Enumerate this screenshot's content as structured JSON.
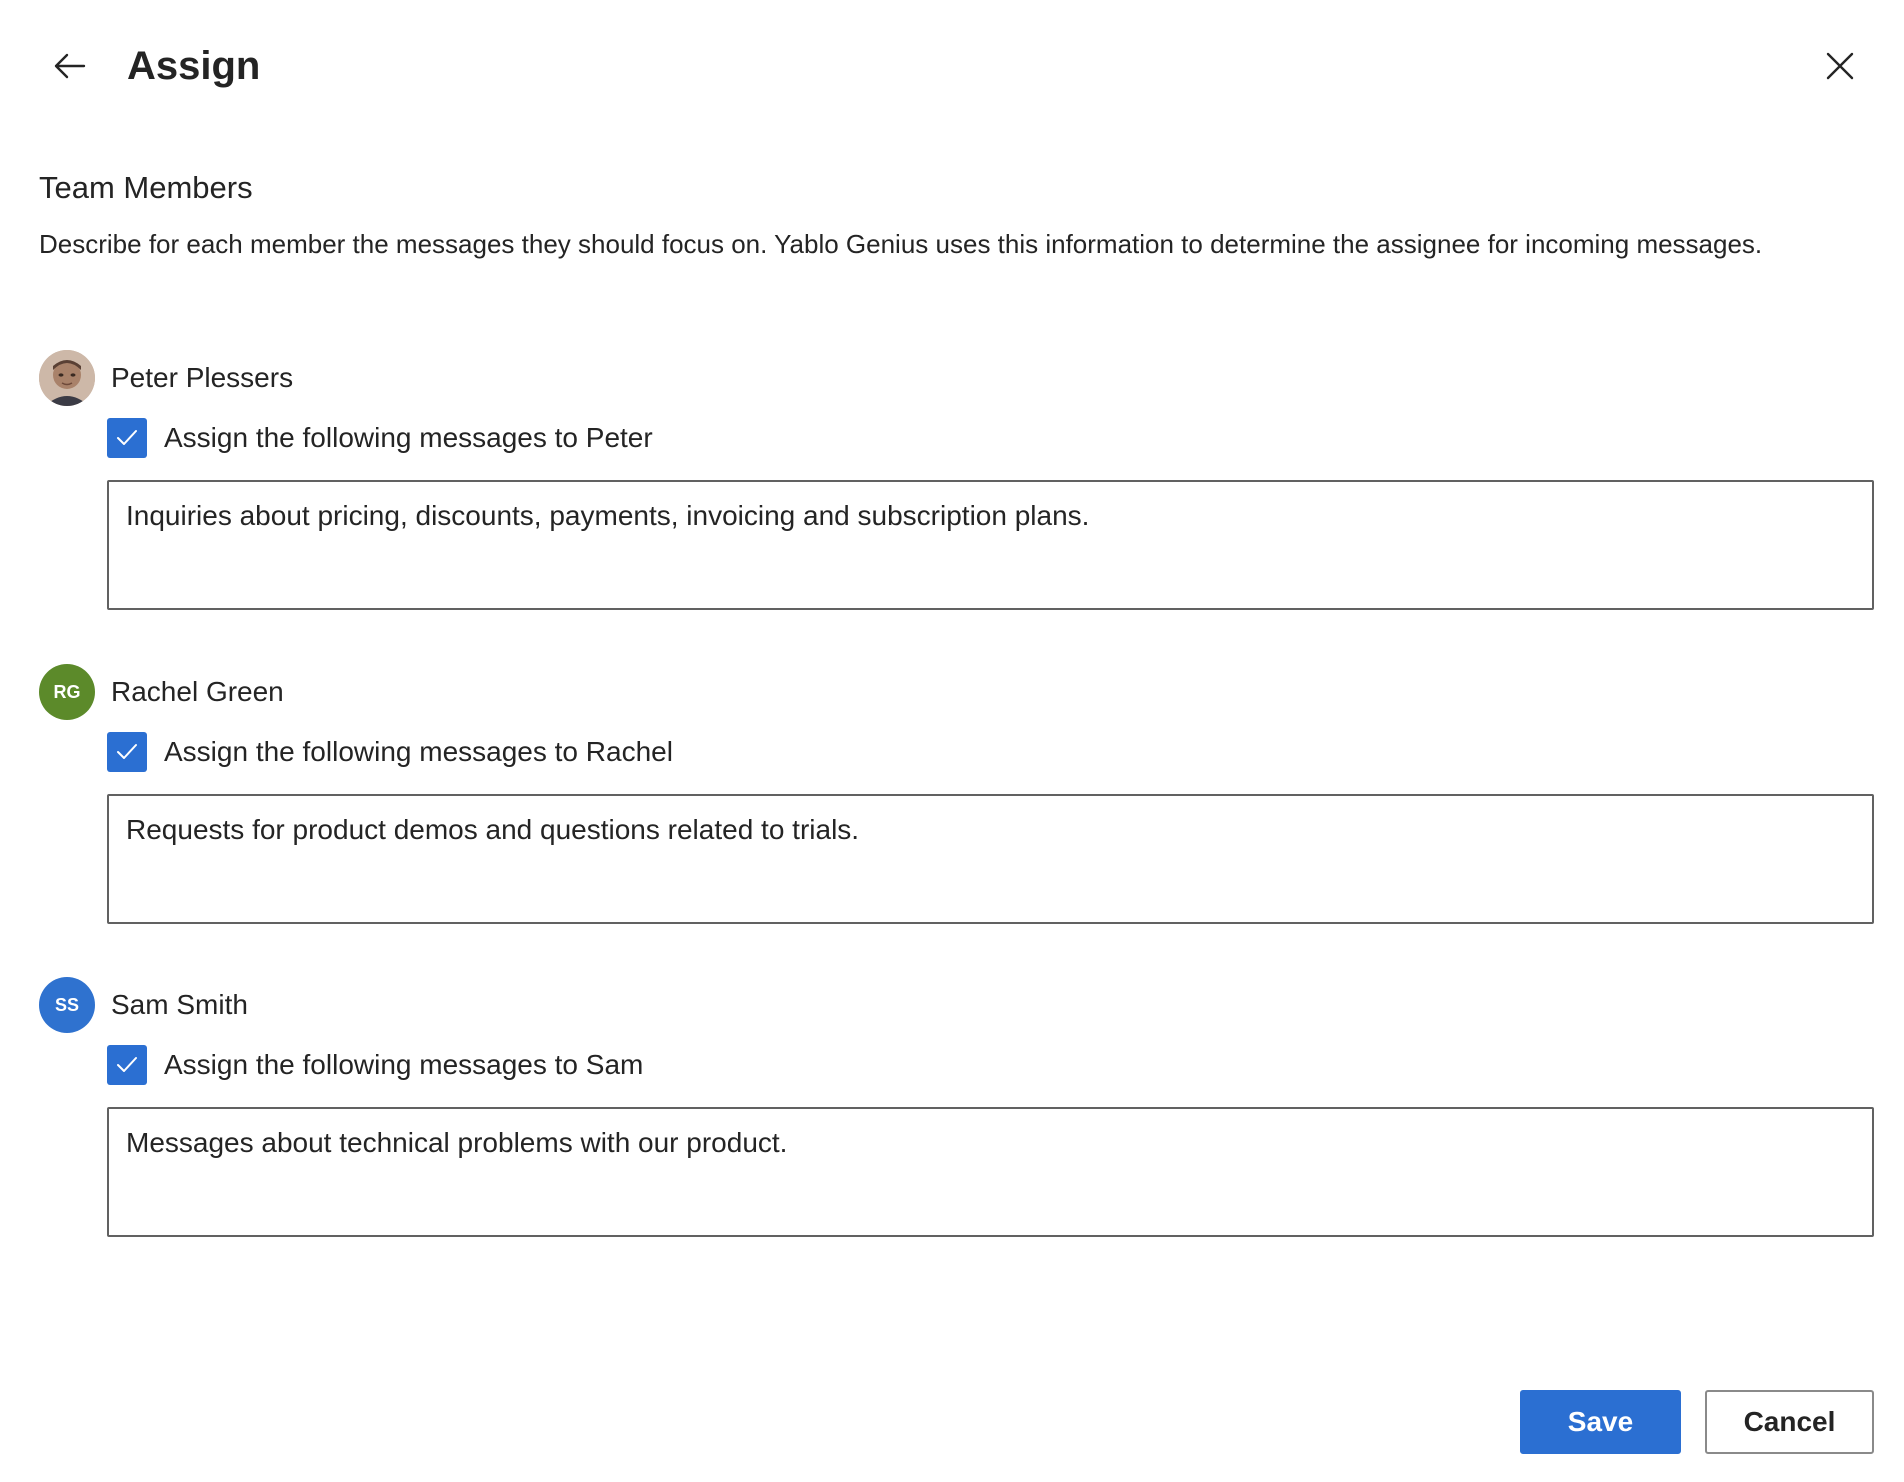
{
  "header": {
    "title": "Assign",
    "back_icon": "arrow-left-icon",
    "close_icon": "close-icon"
  },
  "section": {
    "title": "Team Members",
    "description": "Describe for each member the messages they should focus on. Yablo Genius uses this information to determine the assignee for incoming messages."
  },
  "members": [
    {
      "name": "Peter Plessers",
      "initials": "",
      "avatar_type": "photo",
      "avatar_color": "#8a6a55",
      "checked": true,
      "check_label": "Assign the following messages to Peter",
      "description": "Inquiries about pricing, discounts, payments, invoicing and subscription plans."
    },
    {
      "name": "Rachel Green",
      "initials": "RG",
      "avatar_type": "initials",
      "avatar_color": "#5c8a2a",
      "checked": true,
      "check_label": "Assign the following messages to Rachel",
      "description": "Requests for product demos and questions related to trials."
    },
    {
      "name": "Sam Smith",
      "initials": "SS",
      "avatar_type": "initials",
      "avatar_color": "#2f72cf",
      "checked": true,
      "check_label": "Assign the following messages to Sam",
      "description": "Messages about technical problems with our product."
    }
  ],
  "footer": {
    "save_label": "Save",
    "cancel_label": "Cancel"
  },
  "colors": {
    "accent": "#2b6fd2",
    "text": "#242424",
    "border": "#616161"
  }
}
